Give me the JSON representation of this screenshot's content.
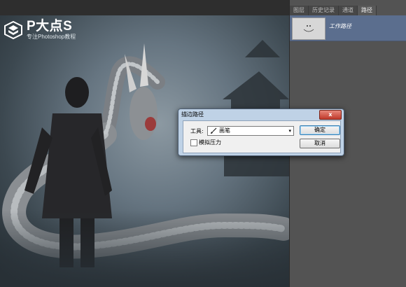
{
  "watermark": {
    "title": "P大点S",
    "subtitle": "专注Photoshop教程"
  },
  "panel": {
    "tabs": [
      {
        "label": "图层",
        "active": false
      },
      {
        "label": "历史记录",
        "active": false
      },
      {
        "label": "通道",
        "active": false
      },
      {
        "label": "路径",
        "active": true
      }
    ],
    "paths": [
      {
        "name": "工作路径",
        "thumbnail_icon": "smiley-path-icon"
      }
    ]
  },
  "dialog": {
    "title": "描边路径",
    "close_label": "x",
    "tool_label": "工具:",
    "tool_value": "画笔",
    "tool_icon": "brush-icon",
    "simulate_pressure_label": "模拟压力",
    "simulate_pressure_checked": false,
    "ok_label": "确定",
    "cancel_label": "取消"
  },
  "colors": {
    "panel_bg": "#535353",
    "selected_path_bg": "#5b6e8e",
    "dialog_frame": "#bfd2e6",
    "close_button": "#c0392b"
  }
}
